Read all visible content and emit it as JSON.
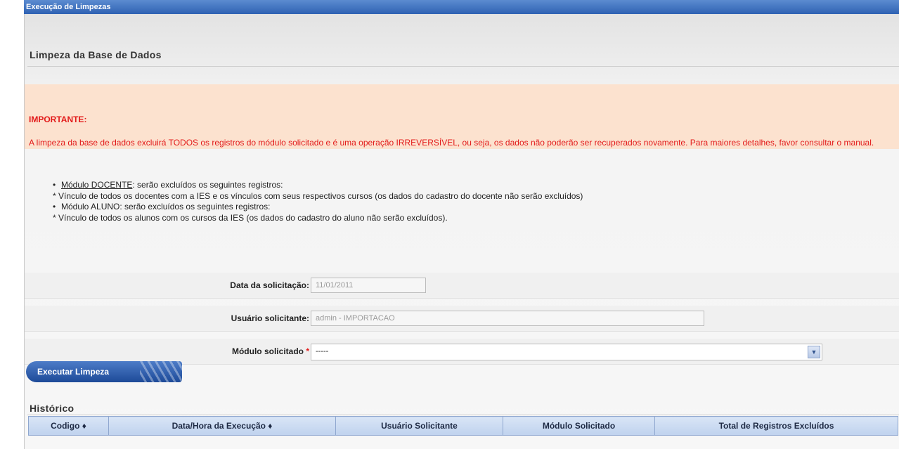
{
  "window": {
    "title": "Execução de Limpezas"
  },
  "page": {
    "title": "Limpeza da Base de Dados"
  },
  "warning": {
    "title": "IMPORTANTE:",
    "text": "A limpeza da base de dados excluirá TODOS os registros do módulo solicitado e é uma operação IRREVERSÍVEL, ou seja, os dados não poderão ser recuperados novamente. Para maiores detalhes, favor consultar o manual."
  },
  "info": {
    "docente_head": "Módulo DOCENTE",
    "docente_rest": ": serão excluídos os seguintes registros:",
    "docente_detail": "* Vínculo de todos os docentes com a IES e os vínculos com seus respectivos cursos (os dados do cadastro do docente não serão excluídos)",
    "aluno_head": "Módulo ALUNO: serão excluídos os seguintes registros:",
    "aluno_detail": "* Vínculo de todos os alunos com os cursos da IES (os dados do cadastro do aluno não serão excluídos)."
  },
  "form": {
    "data_label": "Data da solicitação:",
    "data_value": "11/01/2011",
    "usuario_label": "Usuário solicitante:",
    "usuario_value": "admin - IMPORTACAO",
    "modulo_label": "Módulo solicitado",
    "required_mark": "*",
    "modulo_value": "-----"
  },
  "actions": {
    "execute_label": "Executar Limpeza"
  },
  "history": {
    "title": "Histórico",
    "columns": [
      "Codigo ♦",
      "Data/Hora da Execução ♦",
      "Usuário Solicitante",
      "Módulo Solicitado",
      "Total de Registros Excluídos"
    ]
  },
  "colors": {
    "warning_text": "#e21a1a",
    "warning_bg": "#fce2cf",
    "accent": "#2f62b3"
  }
}
